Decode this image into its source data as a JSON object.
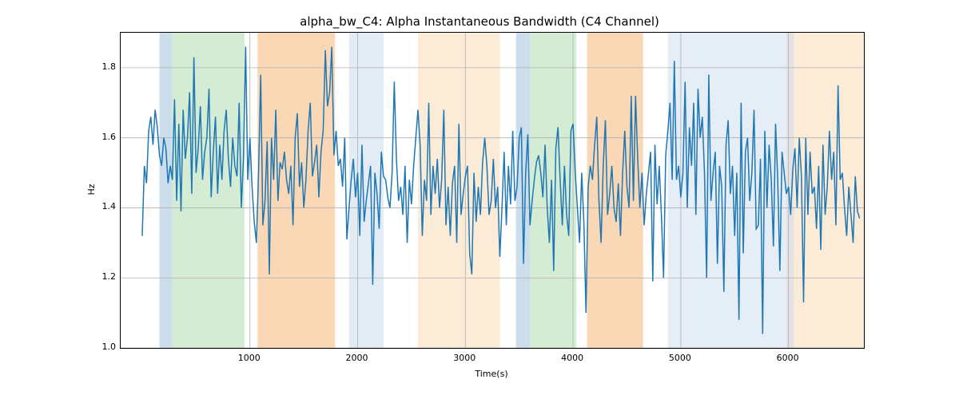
{
  "chart_data": {
    "type": "line",
    "title": "alpha_bw_C4: Alpha Instantaneous Bandwidth (C4 Channel)",
    "xlabel": "Time(s)",
    "ylabel": "Hz",
    "xlim": [
      -200,
      6700
    ],
    "ylim": [
      1.0,
      1.9
    ],
    "x_ticks": [
      1000,
      2000,
      3000,
      4000,
      5000,
      6000
    ],
    "y_ticks": [
      1.0,
      1.2,
      1.4,
      1.6,
      1.8
    ],
    "line_color": "#1f77b4",
    "background_regions": [
      {
        "x0": 160,
        "x1": 280,
        "color": "#8fb6d4",
        "alpha": 0.45
      },
      {
        "x0": 280,
        "x1": 950,
        "color": "#9fd49f",
        "alpha": 0.45
      },
      {
        "x0": 1070,
        "x1": 1790,
        "color": "#f5b878",
        "alpha": 0.55
      },
      {
        "x0": 1920,
        "x1": 2240,
        "color": "#b8cfe6",
        "alpha": 0.4
      },
      {
        "x0": 2560,
        "x1": 3320,
        "color": "#f9dcb6",
        "alpha": 0.55
      },
      {
        "x0": 3470,
        "x1": 3600,
        "color": "#8fb6d4",
        "alpha": 0.45
      },
      {
        "x0": 3600,
        "x1": 4030,
        "color": "#9fd49f",
        "alpha": 0.45
      },
      {
        "x0": 4130,
        "x1": 4650,
        "color": "#f5b878",
        "alpha": 0.55
      },
      {
        "x0": 4880,
        "x1": 5980,
        "color": "#d0dfef",
        "alpha": 0.55
      },
      {
        "x0": 5980,
        "x1": 6050,
        "color": "#b0b0b0",
        "alpha": 0.35
      },
      {
        "x0": 6050,
        "x1": 6700,
        "color": "#f9dcb6",
        "alpha": 0.55
      }
    ],
    "x": [
      0,
      20,
      40,
      60,
      80,
      100,
      120,
      140,
      160,
      180,
      200,
      220,
      240,
      260,
      280,
      300,
      320,
      340,
      360,
      380,
      400,
      420,
      440,
      460,
      480,
      500,
      520,
      540,
      560,
      580,
      600,
      620,
      640,
      660,
      680,
      700,
      720,
      740,
      760,
      780,
      800,
      820,
      840,
      860,
      880,
      900,
      920,
      940,
      960,
      980,
      1000,
      1020,
      1040,
      1060,
      1080,
      1100,
      1120,
      1140,
      1160,
      1180,
      1200,
      1220,
      1240,
      1260,
      1280,
      1300,
      1320,
      1340,
      1360,
      1380,
      1400,
      1420,
      1440,
      1460,
      1480,
      1500,
      1520,
      1540,
      1560,
      1580,
      1600,
      1620,
      1640,
      1660,
      1680,
      1700,
      1720,
      1740,
      1760,
      1780,
      1800,
      1820,
      1840,
      1860,
      1880,
      1900,
      1920,
      1940,
      1960,
      1980,
      2000,
      2020,
      2040,
      2060,
      2080,
      2100,
      2120,
      2140,
      2160,
      2180,
      2200,
      2220,
      2240,
      2260,
      2280,
      2300,
      2320,
      2340,
      2360,
      2380,
      2400,
      2420,
      2440,
      2460,
      2480,
      2500,
      2520,
      2540,
      2560,
      2580,
      2600,
      2620,
      2640,
      2660,
      2680,
      2700,
      2720,
      2740,
      2760,
      2780,
      2800,
      2820,
      2840,
      2860,
      2880,
      2900,
      2920,
      2940,
      2960,
      2980,
      3000,
      3020,
      3040,
      3060,
      3080,
      3100,
      3120,
      3140,
      3160,
      3180,
      3200,
      3220,
      3240,
      3260,
      3280,
      3300,
      3320,
      3340,
      3360,
      3380,
      3400,
      3420,
      3440,
      3460,
      3480,
      3500,
      3520,
      3540,
      3560,
      3580,
      3600,
      3620,
      3640,
      3660,
      3680,
      3700,
      3720,
      3740,
      3760,
      3780,
      3800,
      3820,
      3840,
      3860,
      3880,
      3900,
      3920,
      3940,
      3960,
      3980,
      4000,
      4020,
      4040,
      4060,
      4080,
      4100,
      4120,
      4140,
      4160,
      4180,
      4200,
      4220,
      4240,
      4260,
      4280,
      4300,
      4320,
      4340,
      4360,
      4380,
      4400,
      4420,
      4440,
      4460,
      4480,
      4500,
      4520,
      4540,
      4560,
      4580,
      4600,
      4620,
      4640,
      4660,
      4680,
      4700,
      4720,
      4740,
      4760,
      4780,
      4800,
      4820,
      4840,
      4860,
      4880,
      4900,
      4920,
      4940,
      4960,
      4980,
      5000,
      5020,
      5040,
      5060,
      5080,
      5100,
      5120,
      5140,
      5160,
      5180,
      5200,
      5220,
      5240,
      5260,
      5280,
      5300,
      5320,
      5340,
      5360,
      5380,
      5400,
      5420,
      5440,
      5460,
      5480,
      5500,
      5520,
      5540,
      5560,
      5580,
      5600,
      5620,
      5640,
      5660,
      5680,
      5700,
      5720,
      5740,
      5760,
      5780,
      5800,
      5820,
      5840,
      5860,
      5880,
      5900,
      5920,
      5940,
      5960,
      5980,
      6000,
      6020,
      6040,
      6060,
      6080,
      6100,
      6120,
      6140,
      6160,
      6180,
      6200,
      6220,
      6240,
      6260,
      6280,
      6300,
      6320,
      6340,
      6360,
      6380,
      6400,
      6420,
      6440,
      6460,
      6480,
      6500,
      6520,
      6540,
      6560,
      6580,
      6600,
      6620,
      6640,
      6660
    ],
    "y": [
      1.32,
      1.52,
      1.47,
      1.62,
      1.66,
      1.58,
      1.68,
      1.63,
      1.55,
      1.52,
      1.6,
      1.57,
      1.47,
      1.52,
      1.48,
      1.71,
      1.42,
      1.64,
      1.39,
      1.68,
      1.54,
      1.6,
      1.73,
      1.44,
      1.83,
      1.5,
      1.57,
      1.69,
      1.48,
      1.56,
      1.6,
      1.74,
      1.43,
      1.56,
      1.66,
      1.44,
      1.58,
      1.48,
      1.62,
      1.68,
      1.54,
      1.46,
      1.6,
      1.52,
      1.49,
      1.7,
      1.4,
      1.54,
      1.86,
      1.48,
      1.6,
      1.46,
      1.36,
      1.3,
      1.5,
      1.78,
      1.35,
      1.42,
      1.59,
      1.21,
      1.6,
      1.48,
      1.68,
      1.42,
      1.53,
      1.51,
      1.56,
      1.48,
      1.44,
      1.52,
      1.35,
      1.6,
      1.67,
      1.46,
      1.53,
      1.4,
      1.48,
      1.62,
      1.7,
      1.49,
      1.53,
      1.58,
      1.43,
      1.56,
      1.62,
      1.85,
      1.69,
      1.73,
      1.86,
      1.55,
      1.62,
      1.52,
      1.54,
      1.46,
      1.6,
      1.31,
      1.4,
      1.48,
      1.54,
      1.43,
      1.5,
      1.32,
      1.58,
      1.36,
      1.42,
      1.47,
      1.52,
      1.18,
      1.5,
      1.44,
      1.34,
      1.56,
      1.49,
      1.48,
      1.43,
      1.4,
      1.5,
      1.76,
      1.54,
      1.42,
      1.46,
      1.38,
      1.52,
      1.3,
      1.48,
      1.41,
      1.52,
      1.6,
      1.68,
      1.58,
      1.32,
      1.48,
      1.42,
      1.7,
      1.38,
      1.52,
      1.44,
      1.54,
      1.4,
      1.48,
      1.68,
      1.35,
      1.46,
      1.32,
      1.47,
      1.52,
      1.3,
      1.64,
      1.38,
      1.44,
      1.49,
      1.52,
      1.27,
      1.21,
      1.5,
      1.36,
      1.46,
      1.38,
      1.53,
      1.6,
      1.52,
      1.38,
      1.42,
      1.54,
      1.4,
      1.46,
      1.26,
      1.4,
      1.56,
      1.35,
      1.52,
      1.41,
      1.62,
      1.42,
      1.46,
      1.6,
      1.63,
      1.24,
      1.5,
      1.61,
      1.35,
      1.42,
      1.48,
      1.53,
      1.55,
      1.5,
      1.43,
      1.58,
      1.4,
      1.3,
      1.48,
      1.22,
      1.57,
      1.63,
      1.48,
      1.35,
      1.52,
      1.38,
      1.32,
      1.62,
      1.64,
      1.5,
      1.4,
      1.3,
      1.5,
      1.36,
      1.1,
      1.46,
      1.52,
      1.48,
      1.58,
      1.66,
      1.42,
      1.3,
      1.52,
      1.65,
      1.38,
      1.44,
      1.52,
      1.4,
      1.36,
      1.47,
      1.32,
      1.5,
      1.62,
      1.46,
      1.4,
      1.72,
      1.42,
      1.72,
      1.54,
      1.4,
      1.5,
      1.35,
      1.44,
      1.5,
      1.56,
      1.19,
      1.58,
      1.41,
      1.52,
      1.38,
      1.2,
      1.55,
      1.62,
      1.7,
      1.48,
      1.82,
      1.48,
      1.52,
      1.43,
      1.5,
      1.76,
      1.4,
      1.63,
      1.52,
      1.7,
      1.38,
      1.74,
      1.6,
      1.66,
      1.5,
      1.2,
      1.78,
      1.42,
      1.5,
      1.56,
      1.24,
      1.52,
      1.46,
      1.16,
      1.58,
      1.65,
      1.44,
      1.52,
      1.32,
      1.5,
      1.08,
      1.7,
      1.27,
      1.56,
      1.6,
      1.42,
      1.5,
      1.68,
      1.34,
      1.35,
      1.54,
      1.04,
      1.62,
      1.4,
      1.58,
      1.48,
      1.29,
      1.64,
      1.48,
      1.22,
      1.56,
      1.5,
      1.44,
      1.46,
      1.38,
      1.51,
      1.57,
      1.4,
      1.6,
      1.49,
      1.13,
      1.6,
      1.38,
      1.56,
      1.44,
      1.46,
      1.34,
      1.52,
      1.28,
      1.58,
      1.38,
      1.46,
      1.62,
      1.48,
      1.56,
      1.35,
      1.75,
      1.48,
      1.5,
      1.4,
      1.32,
      1.46,
      1.38,
      1.3,
      1.49,
      1.39,
      1.37
    ]
  }
}
